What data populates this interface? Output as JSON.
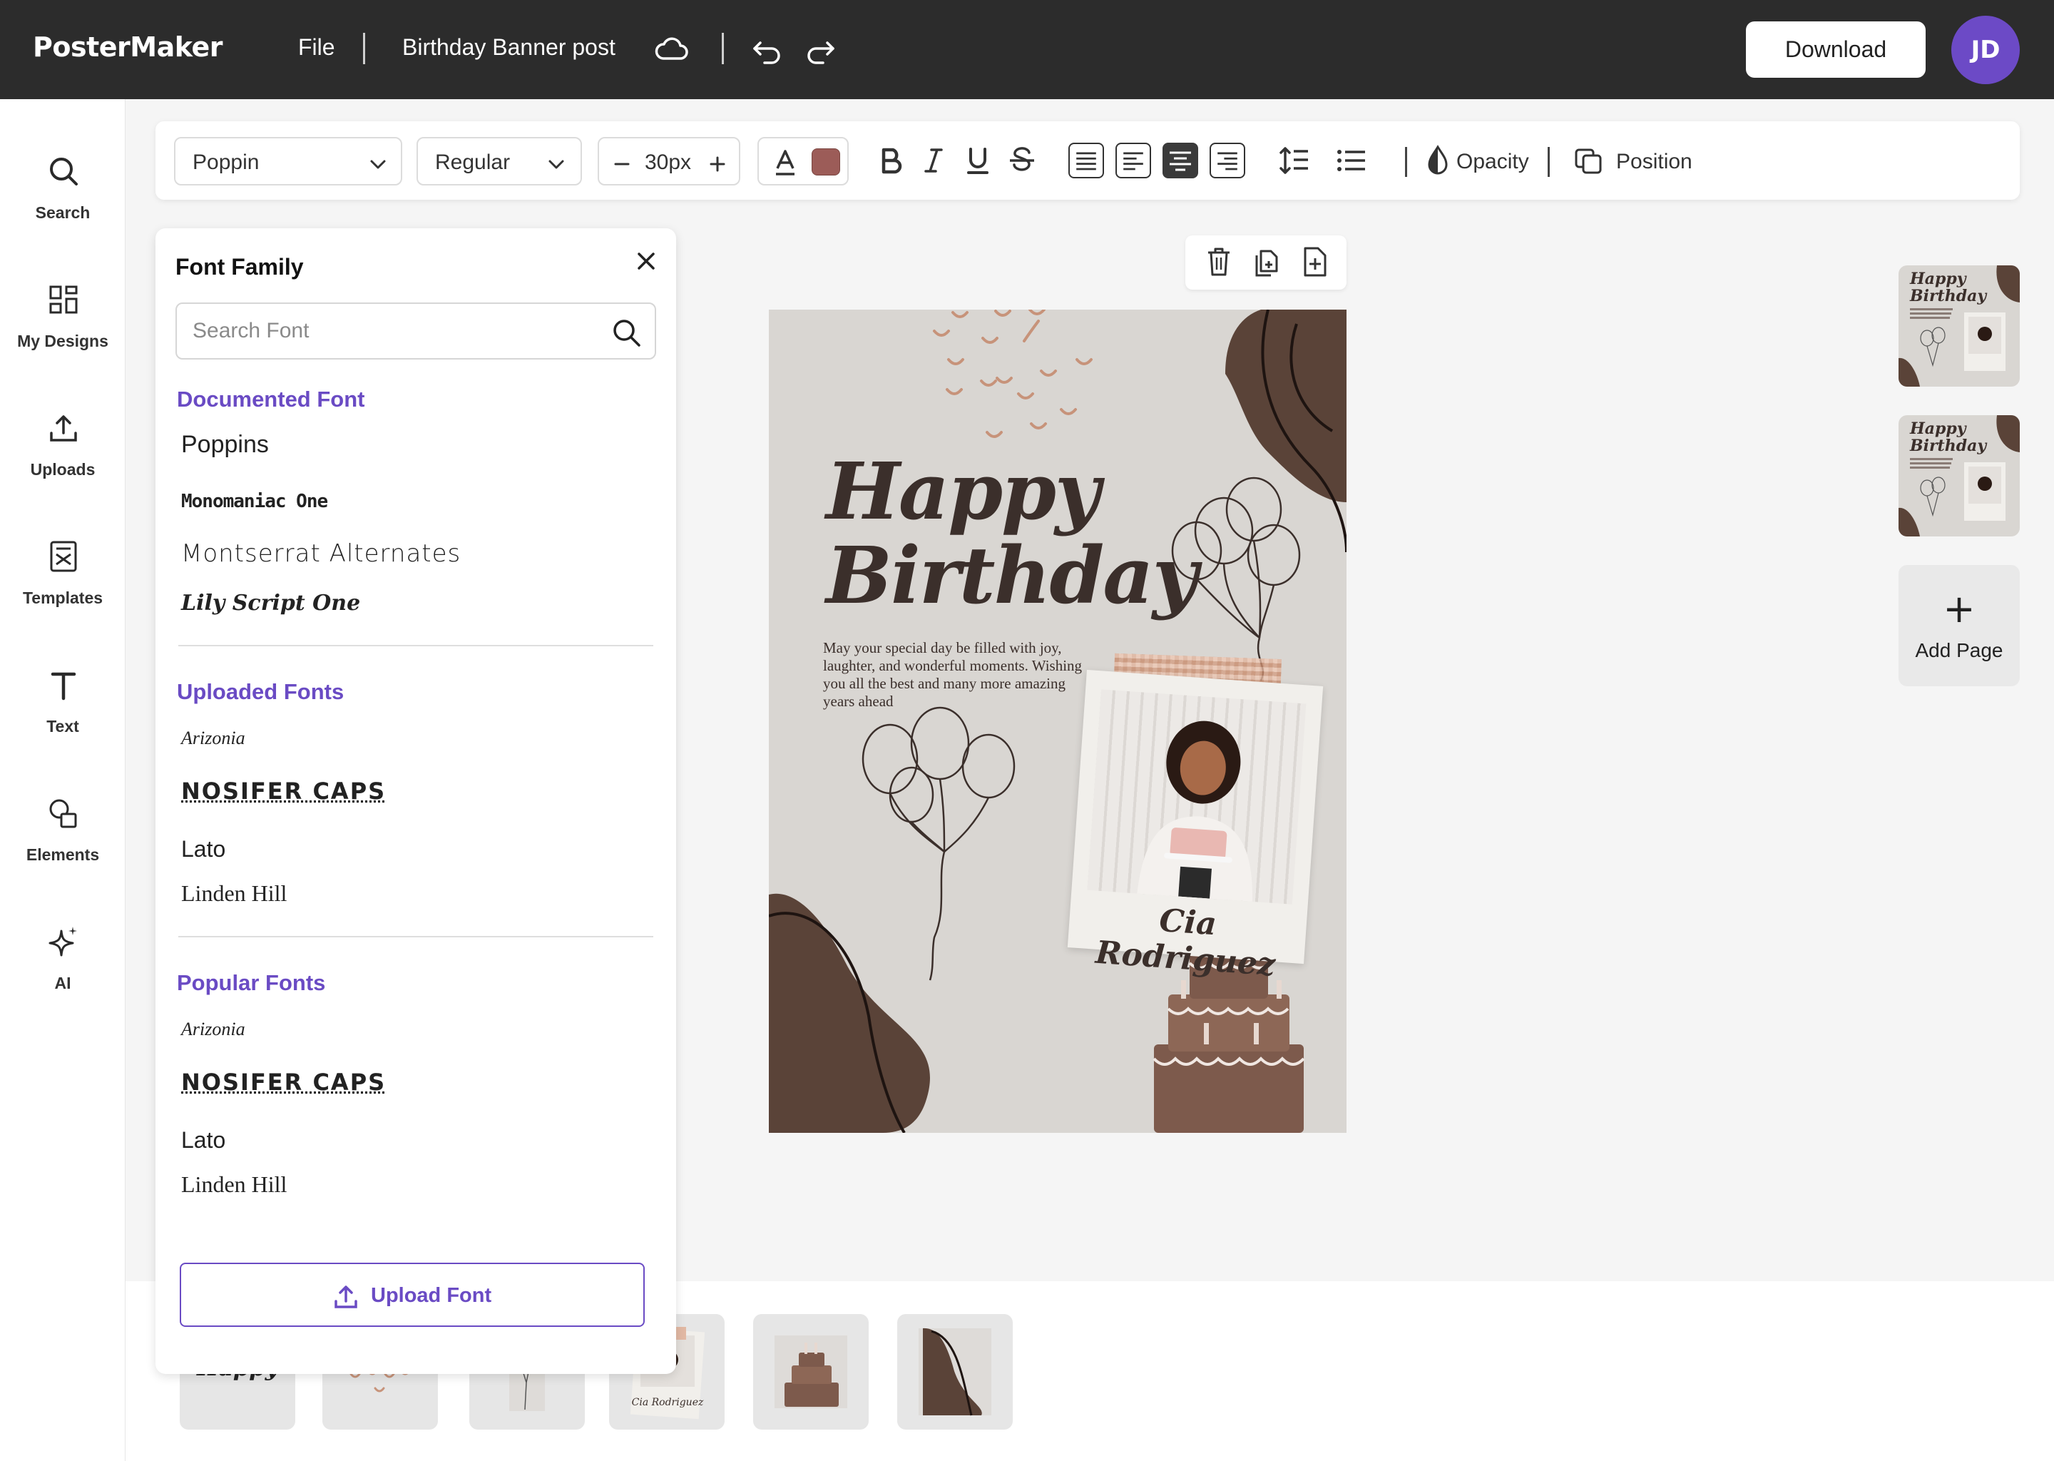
{
  "app": {
    "logo": "PosterMaker",
    "menu_file": "File",
    "document_title": "Birthday Banner post",
    "download_label": "Download",
    "avatar_initials": "JD"
  },
  "sidebar": {
    "items": [
      {
        "label": "Search",
        "icon": "search-icon"
      },
      {
        "label": "My Designs",
        "icon": "grid-icon"
      },
      {
        "label": "Uploads",
        "icon": "upload-icon"
      },
      {
        "label": "Templates",
        "icon": "template-icon"
      },
      {
        "label": "Text",
        "icon": "text-icon"
      },
      {
        "label": "Elements",
        "icon": "shapes-icon"
      },
      {
        "label": "AI",
        "icon": "sparkle-icon"
      }
    ]
  },
  "toolbar": {
    "font_family": "Poppin",
    "font_weight": "Regular",
    "font_size": "30px",
    "text_color": "#9c5c58",
    "opacity_label": "Opacity",
    "position_label": "Position"
  },
  "font_panel": {
    "title": "Font Family",
    "search_placeholder": "Search Font",
    "sections": [
      {
        "title": "Documented Font",
        "fonts": [
          "Poppins",
          "Monomaniac One",
          "Montserrat Alternates",
          "Lily Script One"
        ]
      },
      {
        "title": "Uploaded Fonts",
        "fonts": [
          "Arizonia",
          "NOSIFER CAPS",
          "Lato",
          "Linden Hill"
        ]
      },
      {
        "title": "Popular Fonts",
        "fonts": [
          "Arizonia",
          "NOSIFER CAPS",
          "Lato",
          "Linden Hill"
        ]
      }
    ],
    "upload_label": "Upload Font"
  },
  "poster": {
    "headline_1": "Happy",
    "headline_2": "Birthday",
    "message": "May your special day be filled with joy, laughter, and wonderful moments. Wishing you all the best and many more amazing years ahead",
    "name": "Cia Rodriguez"
  },
  "pages": {
    "add_page_label": "Add Page"
  },
  "bottom_strip": {
    "happy_label": "Happy"
  },
  "colors": {
    "accent": "#6a4bc4",
    "topbar": "#2c2c2c",
    "poster_bg": "#d9d6d2",
    "poster_dark": "#5a4338"
  }
}
